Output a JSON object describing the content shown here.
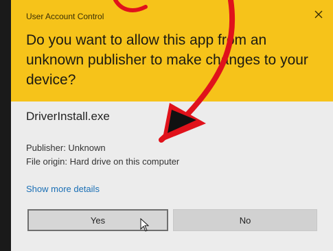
{
  "window": {
    "title": "User Account Control",
    "question": "Do you want to allow this app from an unknown publisher to make changes to your device?"
  },
  "program": {
    "name": "DriverInstall.exe",
    "publisher": "Publisher: Unknown",
    "origin": "File origin: Hard drive on this computer"
  },
  "links": {
    "show_more": "Show more details"
  },
  "buttons": {
    "yes": "Yes",
    "no": "No"
  },
  "icons": {
    "close": "close-icon",
    "cursor": "mouse-pointer-icon",
    "annotation": "red-arrow-annotation"
  },
  "colors": {
    "header": "#f6c31a",
    "dialog": "#ececec",
    "link": "#1a6fb5",
    "annotation": "#e0121b"
  }
}
